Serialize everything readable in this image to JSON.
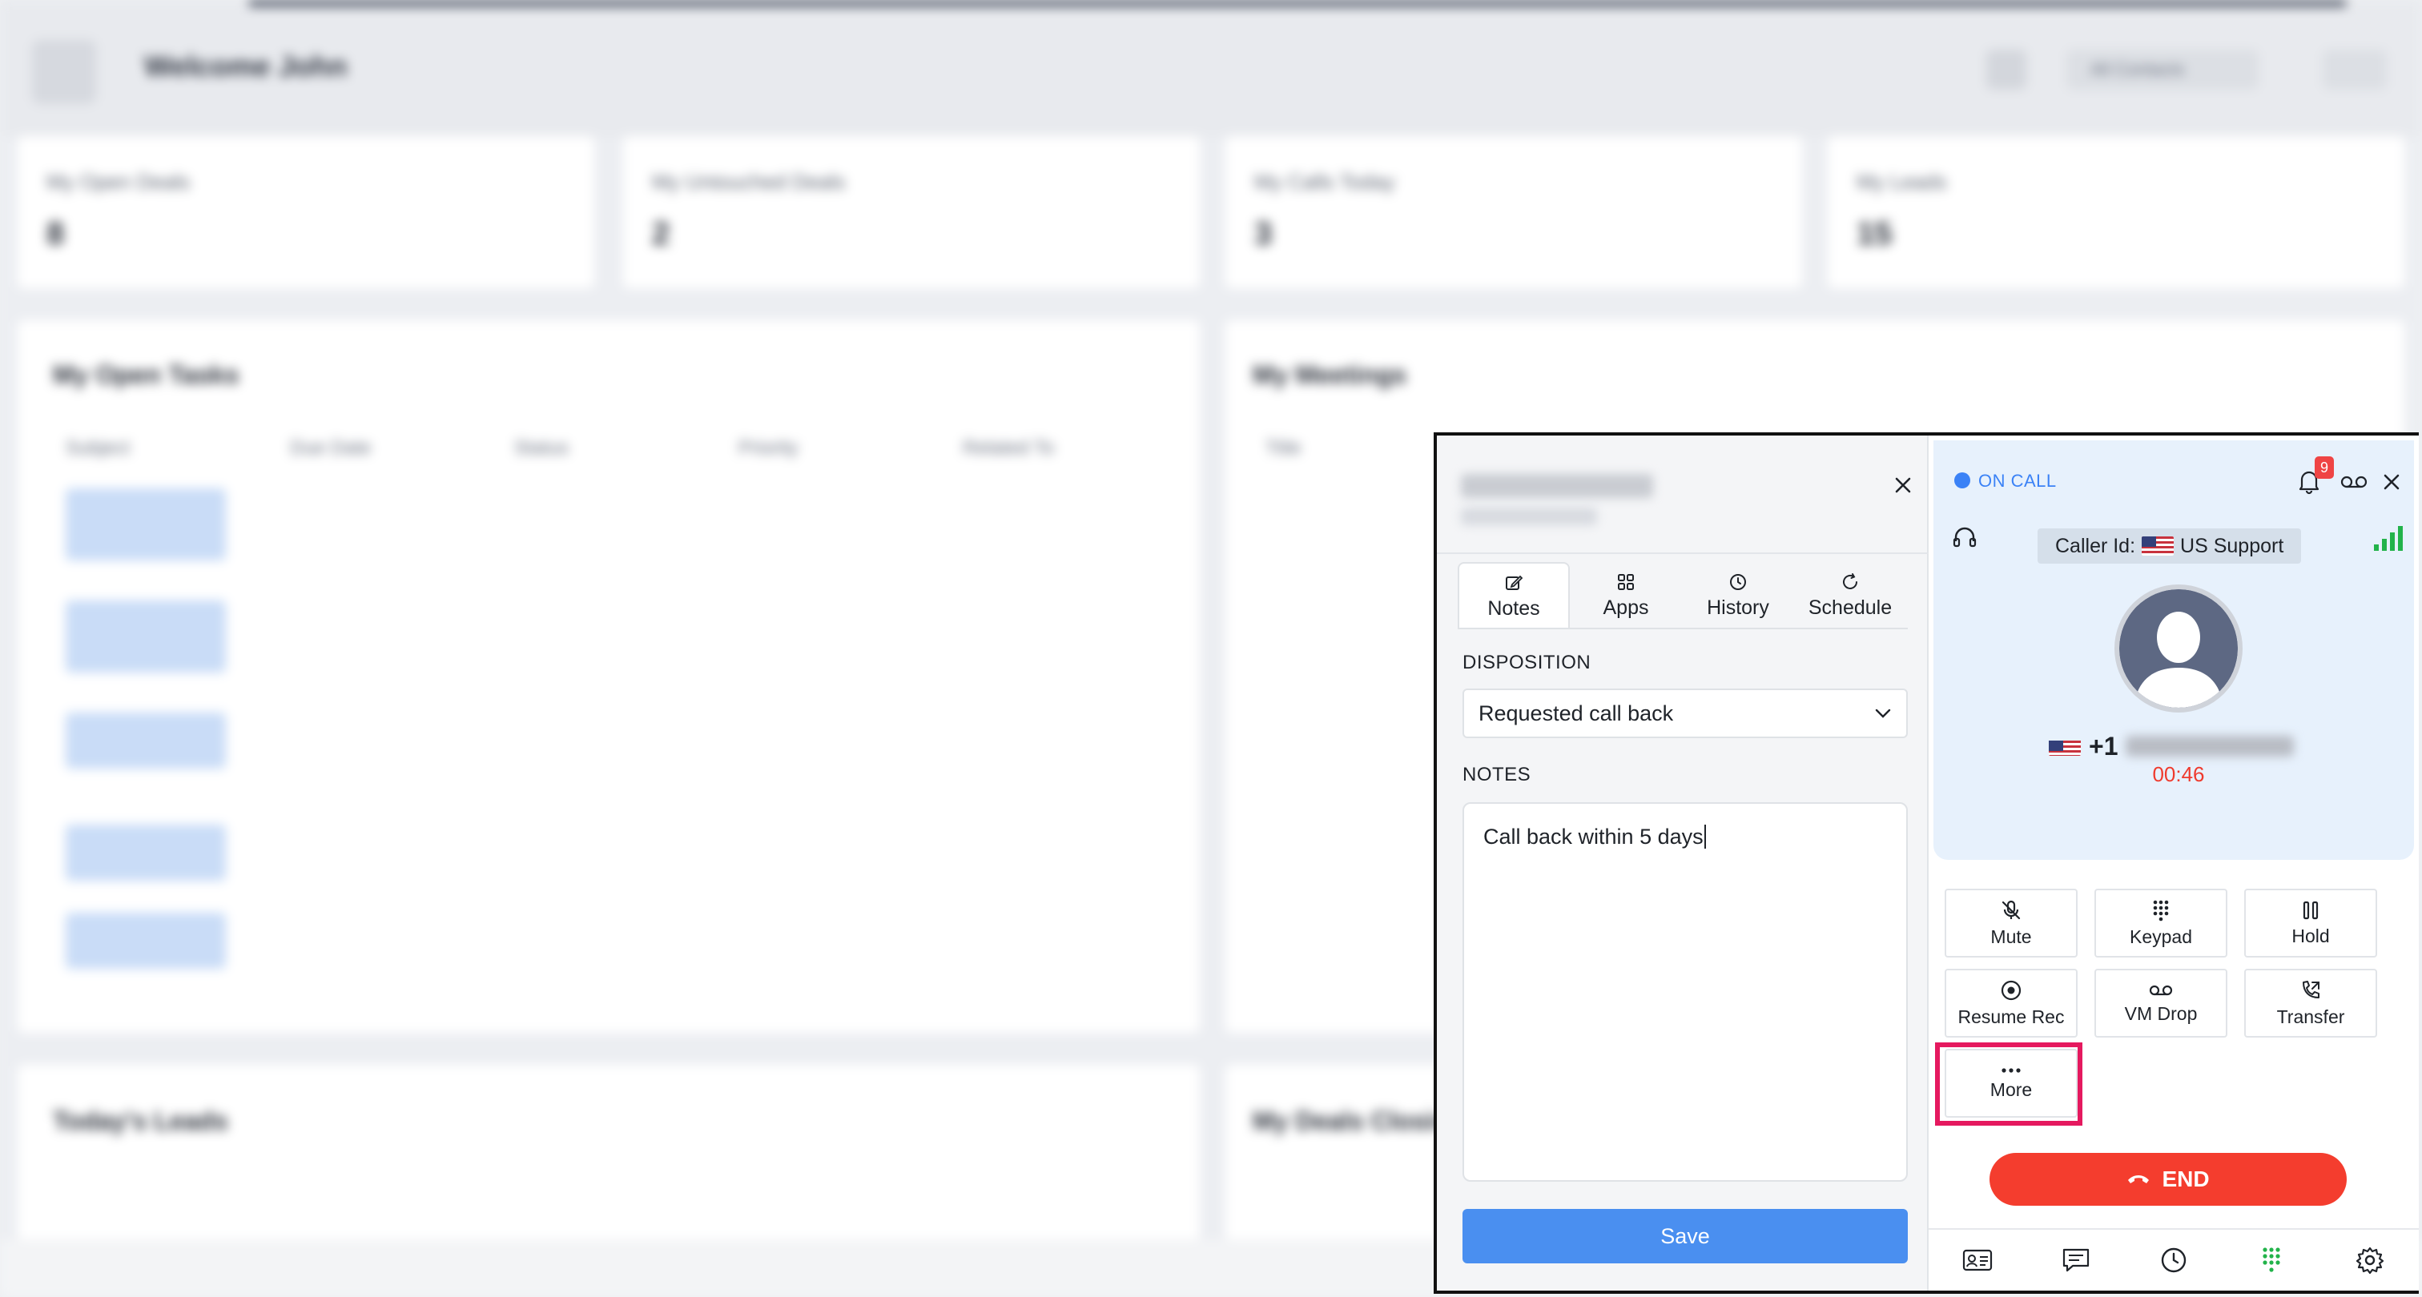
{
  "background": {
    "welcome_title": "Welcome John",
    "top_control_label": "All Contacts",
    "stat_cards": [
      {
        "label": "My Open Deals",
        "value": "8"
      },
      {
        "label": "My Untouched Deals",
        "value": "2"
      },
      {
        "label": "My Calls Today",
        "value": "3"
      },
      {
        "label": "My Leads",
        "value": "15"
      }
    ],
    "open_tasks_title": "My Open Tasks",
    "task_columns": [
      "Subject",
      "Due Date",
      "Status",
      "Priority",
      "Related To"
    ],
    "meetings_title": "My Meetings",
    "meetings_column": "Title",
    "leads_title": "Today's Leads",
    "deals_closing_title": "My Deals Closing"
  },
  "notes_panel": {
    "tabs": [
      {
        "label": "Notes",
        "icon": "edit-icon",
        "active": true
      },
      {
        "label": "Apps",
        "icon": "grid-icon",
        "active": false
      },
      {
        "label": "History",
        "icon": "clock-icon",
        "active": false
      },
      {
        "label": "Schedule",
        "icon": "refresh-icon",
        "active": false
      }
    ],
    "disposition_label": "DISPOSITION",
    "disposition_value": "Requested call back",
    "notes_label": "NOTES",
    "notes_value": "Call back within 5 days",
    "save_label": "Save"
  },
  "dialer": {
    "status": "ON CALL",
    "notification_count": "9",
    "caller_id_label": "Caller Id:",
    "caller_id_value": "US Support",
    "country_code": "+1",
    "timer": "00:46",
    "controls": [
      {
        "label": "Mute",
        "icon": "mic-off-icon"
      },
      {
        "label": "Keypad",
        "icon": "keypad-icon"
      },
      {
        "label": "Hold",
        "icon": "pause-icon"
      },
      {
        "label": "Resume Rec",
        "icon": "record-icon"
      },
      {
        "label": "VM Drop",
        "icon": "voicemail-icon"
      },
      {
        "label": "Transfer",
        "icon": "transfer-icon"
      },
      {
        "label": "More",
        "icon": "more-icon"
      }
    ],
    "end_label": "END",
    "accent_color": "#3b82f6",
    "end_color": "#f43d2e",
    "highlight_color": "#e5195f"
  }
}
